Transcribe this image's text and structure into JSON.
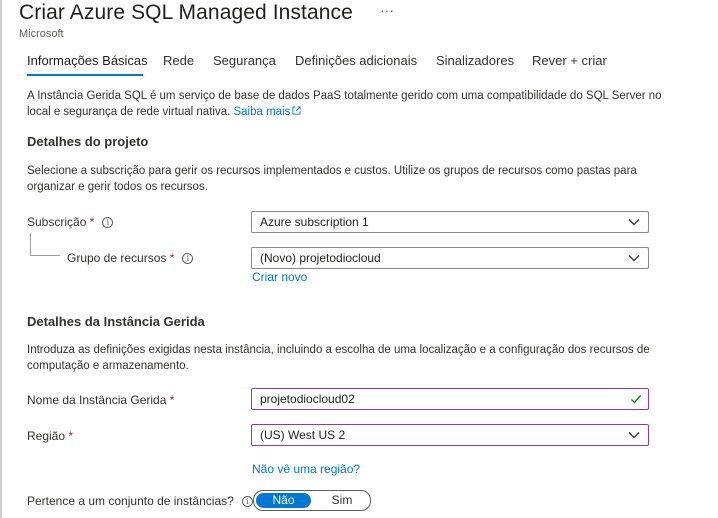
{
  "header": {
    "title": "Criar Azure SQL Managed Instance",
    "more": "···",
    "publisher": "Microsoft"
  },
  "tabs": [
    {
      "label": "Informações Básicas",
      "active": true
    },
    {
      "label": "Rede"
    },
    {
      "label": "Segurança"
    },
    {
      "label": "Definições adicionais"
    },
    {
      "label": "Sinalizadores"
    },
    {
      "label": "Rever + criar"
    }
  ],
  "intro": {
    "text": "A Instância Gerida SQL é um serviço de base de dados PaaS totalmente gerido com uma compatibilidade do SQL Server no local e segurança de rede virtual nativa. ",
    "link": "Saiba mais"
  },
  "project": {
    "heading": "Detalhes do projeto",
    "description": "Selecione a subscrição para gerir os recursos implementados e custos. Utilize os grupos de recursos como pastas para organizar e gerir todos os recursos.",
    "subscription_label": "Subscrição",
    "subscription_value": "Azure subscription 1",
    "resource_group_label": "Grupo de recursos",
    "resource_group_value": "(Novo) projetodiocloud",
    "create_new": "Criar novo"
  },
  "instance": {
    "heading": "Detalhes da Instância Gerida",
    "description": "Introduza as definições exigidas nesta instância, incluindo a escolha de uma localização e a configuração dos recursos de computação e armazenamento.",
    "name_label": "Nome da Instância Gerida",
    "name_value": "projetodiocloud02",
    "region_label": "Região",
    "region_value": "(US) West US 2",
    "region_link": "Não vê uma região?",
    "pool_label": "Pertence a um conjunto de instâncias?",
    "pool_no": "Não",
    "pool_yes": "Sim"
  },
  "colors": {
    "accent": "#0078d4",
    "focus_border": "#8a3bb5",
    "required": "#a4262c",
    "valid": "#107c10"
  }
}
